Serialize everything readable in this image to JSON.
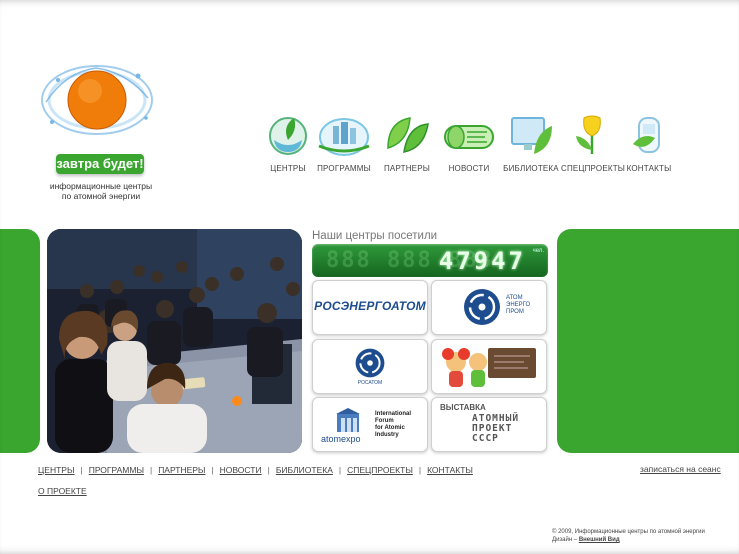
{
  "brand": {
    "slogan": "завтра будет!",
    "tagline_line1": "информационные центры",
    "tagline_line2": "по атомной энергии"
  },
  "nav": {
    "items": [
      {
        "label": "ЦЕНТРЫ",
        "icon": "leaf-bowl-icon"
      },
      {
        "label": "ПРОГРАММЫ",
        "icon": "city-bubble-icon"
      },
      {
        "label": "ПАРТНЕРЫ",
        "icon": "two-leaves-icon"
      },
      {
        "label": "НОВОСТИ",
        "icon": "newspaper-roll-icon"
      },
      {
        "label": "БИБЛИОТЕКА",
        "icon": "monitor-leaf-icon"
      },
      {
        "label": "СПЕЦПРОЕКТЫ",
        "icon": "tulip-icon"
      },
      {
        "label": "КОНТАКТЫ",
        "icon": "phone-leaf-icon"
      }
    ]
  },
  "counter": {
    "title": "Наши центры посетили",
    "ghost": "888 888 888",
    "value": "47947",
    "unit": "чел."
  },
  "partners": {
    "rosenergoatom": "РОСЭНЕРГОАТОМ",
    "atomenergoprom_line1": "АТОМ",
    "atomenergoprom_line2": "ЭНЕРГО",
    "atomenergoprom_line3": "ПРОМ",
    "rosatom": "РОСАТОМ",
    "forum_line1": "International",
    "forum_line2": "Forum",
    "forum_line3": "for Atomic",
    "forum_line4": "Industry",
    "atomexpo": "atomexpo",
    "exhibition_title": "ВЫСТАВКА",
    "exhibition_line1": "АТОМНЫЙ",
    "exhibition_line2": "ПРОЕКТ",
    "exhibition_line3": "СССР"
  },
  "footer": {
    "links": [
      "ЦЕНТРЫ",
      "ПРОГРАММЫ",
      "ПАРТНЕРЫ",
      "НОВОСТИ",
      "БИБЛИОТЕКА",
      "СПЕЦПРОЕКТЫ",
      "КОНТАКТЫ"
    ],
    "separator": "|",
    "about": "О ПРОЕКТЕ",
    "signup": "записаться на сеанс",
    "copyright": "© 2009, Информационные центры по атомной энергии",
    "design_prefix": "Дизайн –",
    "design_studio": "Внешний Вид"
  },
  "colors": {
    "brand_green": "#3aa630",
    "counter_green": "#15651f",
    "partner_blue": "#1d4d8f"
  }
}
